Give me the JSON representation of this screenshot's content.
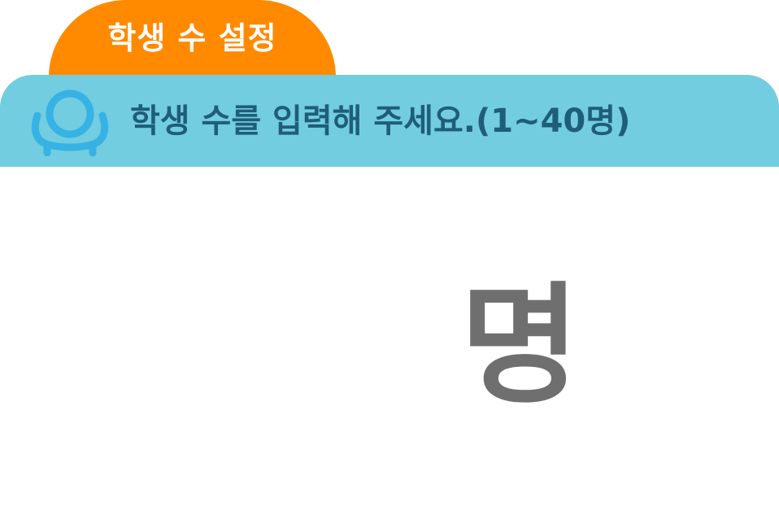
{
  "tab": {
    "title": "학생 수 설정"
  },
  "banner": {
    "icon": "student-icon",
    "instruction": "학생 수를 입력해 주세요.(1~40명)"
  },
  "student_count": {
    "value": "",
    "unit": "명"
  },
  "colors": {
    "tab": "#ff8a00",
    "banner": "#72cde0",
    "banner_text": "#1f5d78",
    "icon": "#37b2e4",
    "unit_text": "#6f6f6f"
  }
}
